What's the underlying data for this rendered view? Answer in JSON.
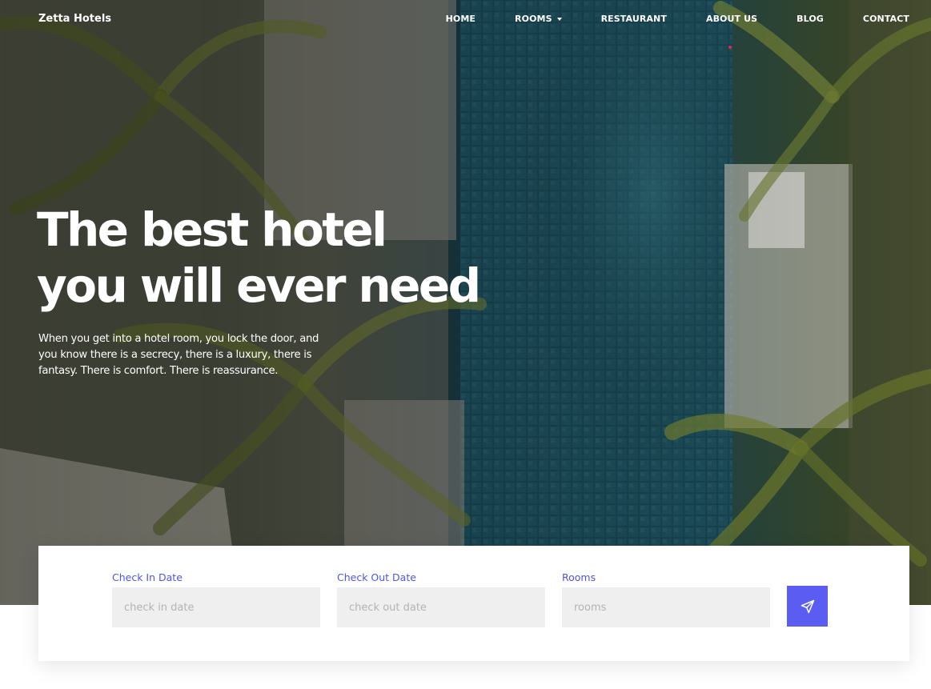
{
  "brand": "Zetta Hotels",
  "nav": {
    "items": [
      {
        "label": "HOME"
      },
      {
        "label": "ROOMS"
      },
      {
        "label": "RESTAURANT"
      },
      {
        "label": "ABOUT US"
      },
      {
        "label": "BLOG"
      },
      {
        "label": "CONTACT"
      }
    ],
    "accent": "#e8283c"
  },
  "hero": {
    "title_line1": "The best hotel",
    "title_line2": "you will ever need",
    "description": "When you get into a hotel room, you lock the door, and you know there is a secrecy, there is a luxury, there is fantasy. There is comfort. There is reassurance."
  },
  "booking": {
    "check_in": {
      "label": "Check In Date",
      "placeholder": "check in date"
    },
    "check_out": {
      "label": "Check Out Date",
      "placeholder": "check out date"
    },
    "rooms": {
      "label": "Rooms",
      "placeholder": "rooms"
    },
    "submit_icon": "paper-plane-icon",
    "accent": "#5a5cf2",
    "label_color": "#4e54e6"
  }
}
